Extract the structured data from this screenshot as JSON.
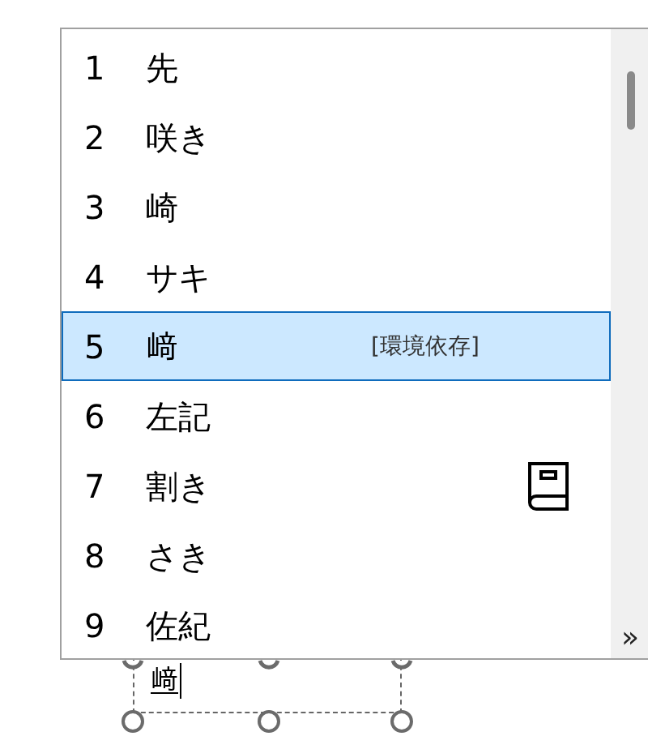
{
  "candidates": [
    {
      "number": "1",
      "text": "先",
      "selected": false
    },
    {
      "number": "2",
      "text": "咲き",
      "selected": false
    },
    {
      "number": "3",
      "text": "崎",
      "selected": false
    },
    {
      "number": "4",
      "text": "サキ",
      "selected": false
    },
    {
      "number": "5",
      "text": "﨑",
      "note": "[環境依存]",
      "selected": true
    },
    {
      "number": "6",
      "text": "左記",
      "selected": false
    },
    {
      "number": "7",
      "text": "割き",
      "dictionary": true,
      "selected": false
    },
    {
      "number": "8",
      "text": "さき",
      "selected": false
    },
    {
      "number": "9",
      "text": "佐紀",
      "selected": false
    }
  ],
  "expand_button": "»",
  "composition": {
    "text": "﨑"
  }
}
